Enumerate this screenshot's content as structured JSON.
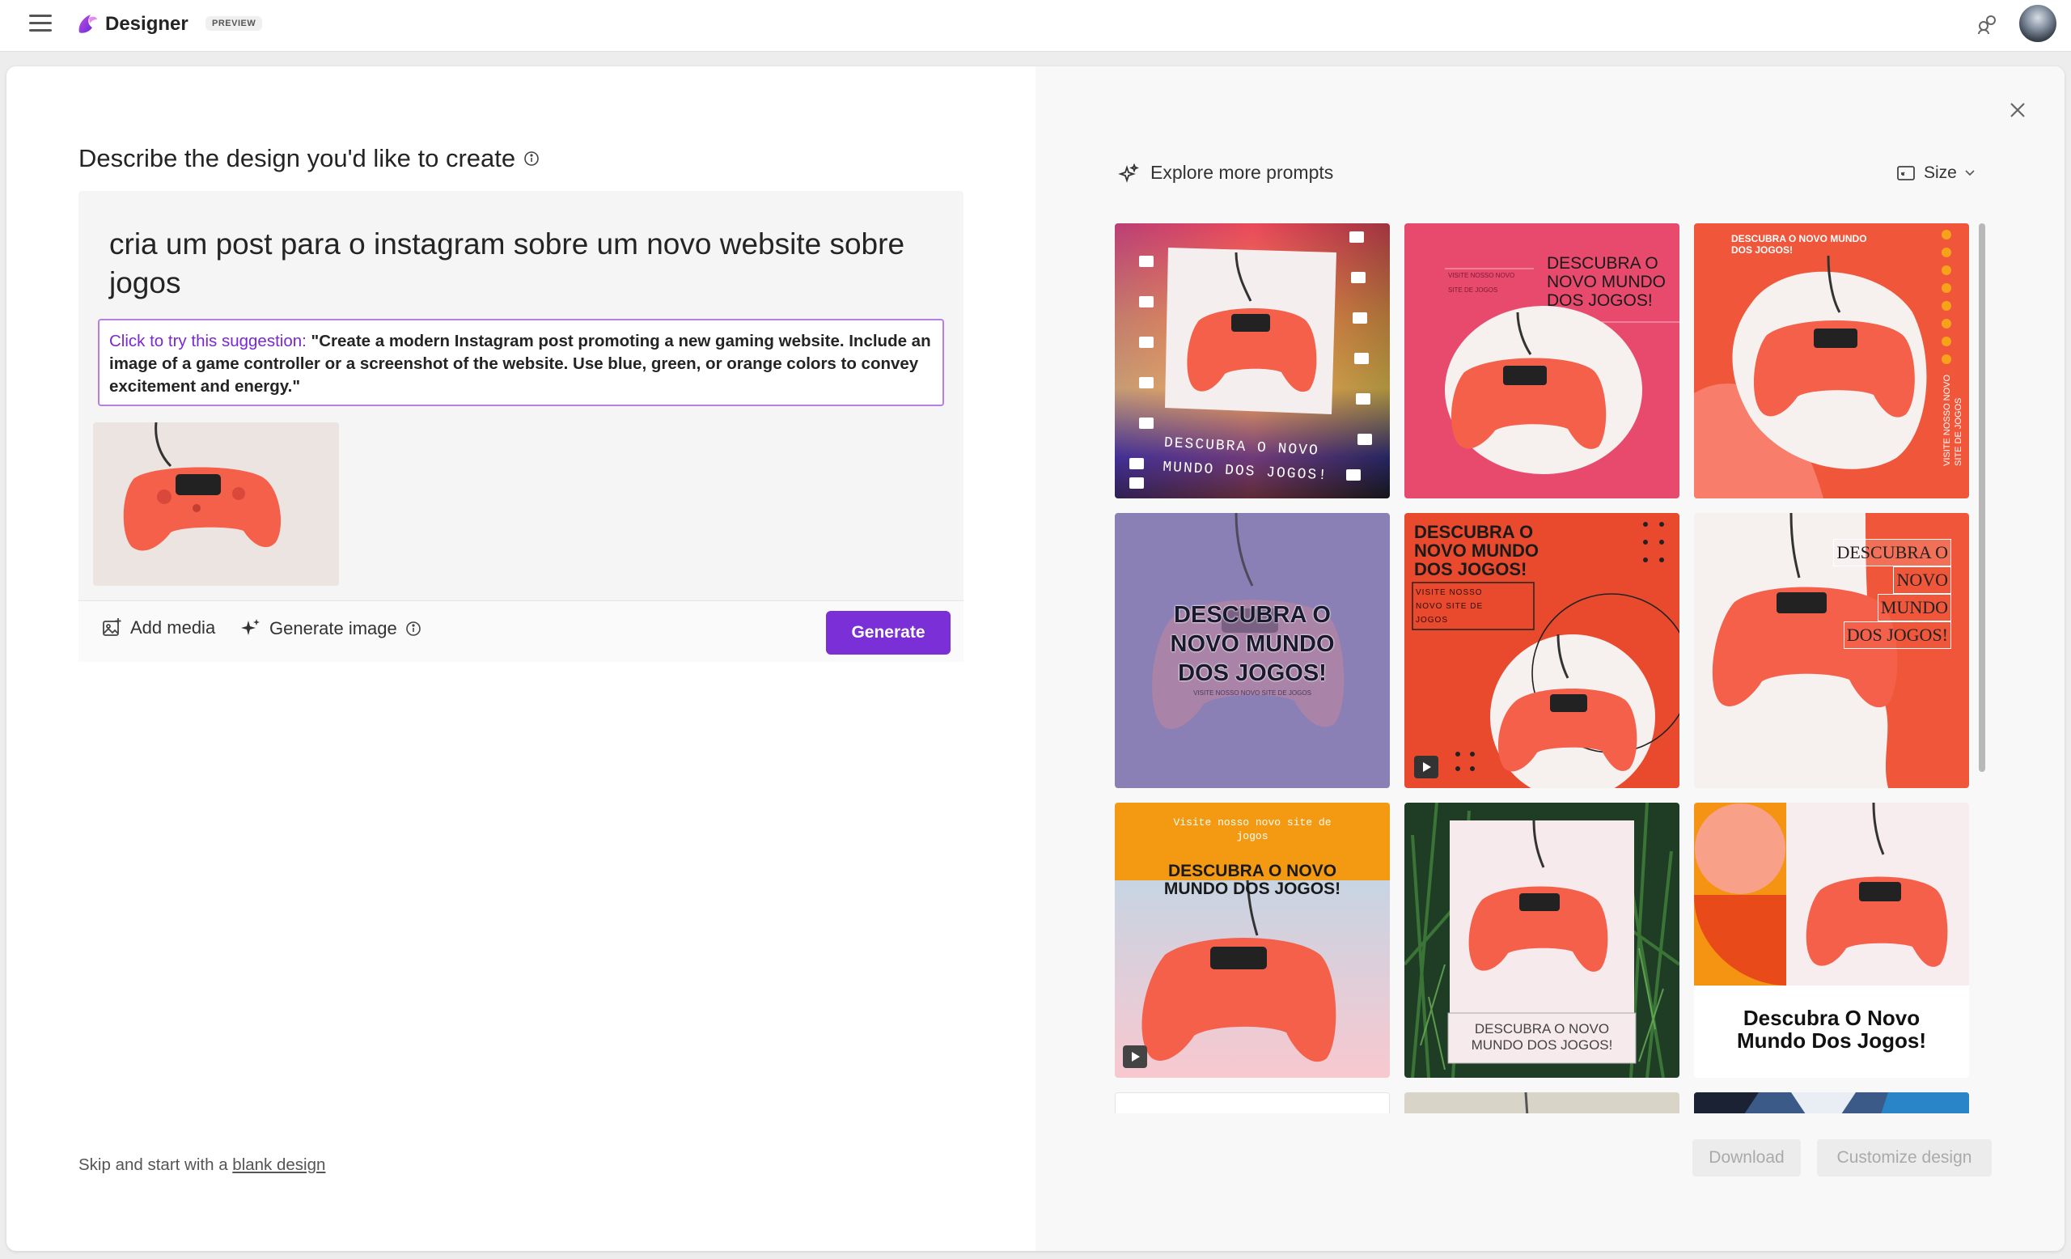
{
  "app": {
    "brand": "Designer",
    "badge": "PREVIEW"
  },
  "left": {
    "heading": "Describe the design you'd like to create",
    "prompt": "cria um post para o instagram sobre um novo website sobre jogos",
    "suggestion_lead": "Click to try this suggestion:",
    "suggestion_text": "\"Create a modern Instagram post promoting a new gaming website. Include an image of a game controller or a screenshot of the website. Use blue, green, or orange colors to convey excitement and energy.\"",
    "add_media": "Add media",
    "generate_image": "Generate image",
    "generate": "Generate",
    "skip_prefix": "Skip and start with a",
    "skip_link": "blank design"
  },
  "right": {
    "explore": "Explore more prompts",
    "size": "Size",
    "download": "Download",
    "customize": "Customize design"
  },
  "designs": {
    "d1": "DESCUBRA O NOVO\nMUNDO DOS JOGOS!",
    "d2_small": "VISITE NOSSO NOVO\nSITE DE JOGOS",
    "d2_title": "DESCUBRA O\nNOVO MUNDO\nDOS JOGOS!",
    "d3_top": "DESCUBRA O NOVO MUNDO\nDOS JOGOS!",
    "d3_side": "VISITE NOSSO NOVO\nSITE DE JOGOS",
    "d4_title": "DESCUBRA O\nNOVO MUNDO\nDOS JOGOS!",
    "d4_small": "VISITE NOSSO NOVO SITE DE JOGOS",
    "d5_title": "DESCUBRA O\nNOVO MUNDO\nDOS JOGOS!",
    "d5_small": "VISITE NOSSO\nNOVO SITE DE\nJOGOS",
    "d6_title": [
      "DESCUBRA O",
      "NOVO",
      "MUNDO",
      "DOS JOGOS!"
    ],
    "d7_small": "Visite nosso novo site de\njogos",
    "d7_title": "DESCUBRA O NOVO\nMUNDO DOS JOGOS!",
    "d8": "DESCUBRA O NOVO\nMUNDO DOS JOGOS!",
    "d9": "Descubra O Novo\nMundo Dos Jogos!"
  },
  "colors": {
    "accent": "#7b2fd6",
    "controller": "#f4604a"
  }
}
